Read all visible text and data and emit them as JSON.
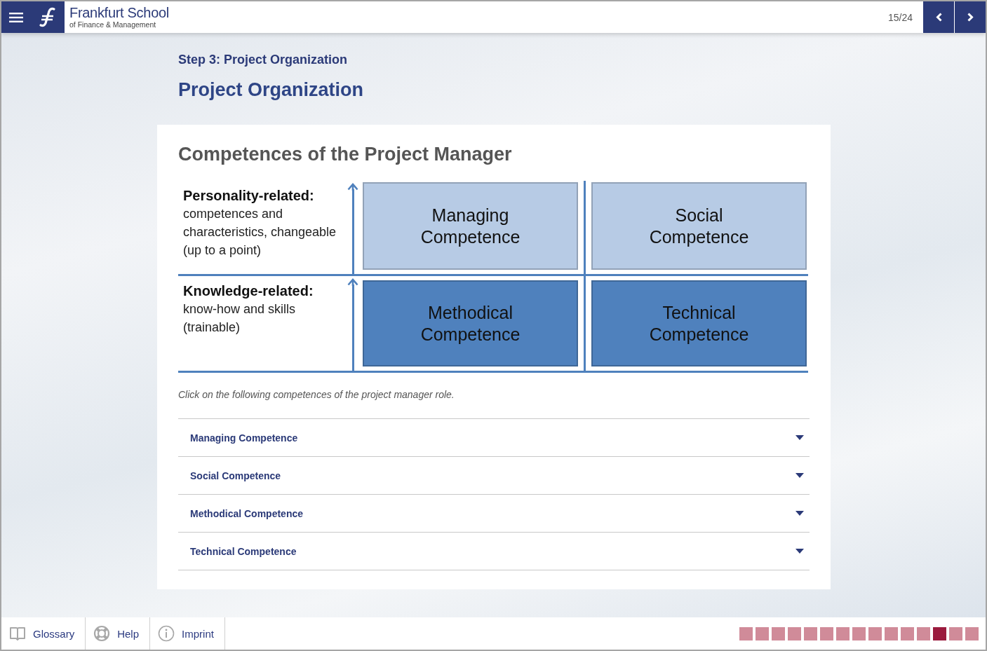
{
  "header": {
    "logo_title": "Frankfurt School",
    "logo_subtitle": "of Finance & Management",
    "page_counter": "15/24"
  },
  "page": {
    "step_label": "Step 3: Project Organization",
    "title": "Project Organization"
  },
  "card": {
    "heading": "Competences of the Project Manager",
    "diagram": {
      "rows": [
        {
          "label": "Personality-related:",
          "description": "competences and characteristics, changeable (up to a point)",
          "boxes": [
            {
              "label": "Managing Competence",
              "color": "#b7cbe5"
            },
            {
              "label": "Social Competence",
              "color": "#b7cbe5"
            }
          ]
        },
        {
          "label": "Knowledge-related:",
          "description": "know-how and skills (trainable)",
          "boxes": [
            {
              "label": "Methodical Competence",
              "color": "#4f81bd"
            },
            {
              "label": "Technical Competence",
              "color": "#4f81bd"
            }
          ]
        }
      ]
    },
    "instruction": "Click on the following competences of the project manager role.",
    "accordion": [
      {
        "label": "Managing Competence",
        "expanded": false
      },
      {
        "label": "Social Competence",
        "expanded": false
      },
      {
        "label": "Methodical Competence",
        "expanded": false
      },
      {
        "label": "Technical Competence",
        "expanded": false
      }
    ]
  },
  "footer": {
    "links": [
      {
        "label": "Glossary",
        "kind": "book"
      },
      {
        "label": "Help",
        "kind": "lifebuoy"
      },
      {
        "label": "Imprint",
        "kind": "info"
      }
    ],
    "progress": [
      {
        "selected": false
      },
      {
        "selected": false
      },
      {
        "selected": false
      },
      {
        "selected": false
      },
      {
        "selected": false
      },
      {
        "selected": false
      },
      {
        "selected": false
      },
      {
        "selected": false
      },
      {
        "selected": false
      },
      {
        "selected": false
      },
      {
        "selected": false
      },
      {
        "selected": false
      },
      {
        "selected": true
      },
      {
        "selected": false
      },
      {
        "selected": false
      }
    ]
  }
}
